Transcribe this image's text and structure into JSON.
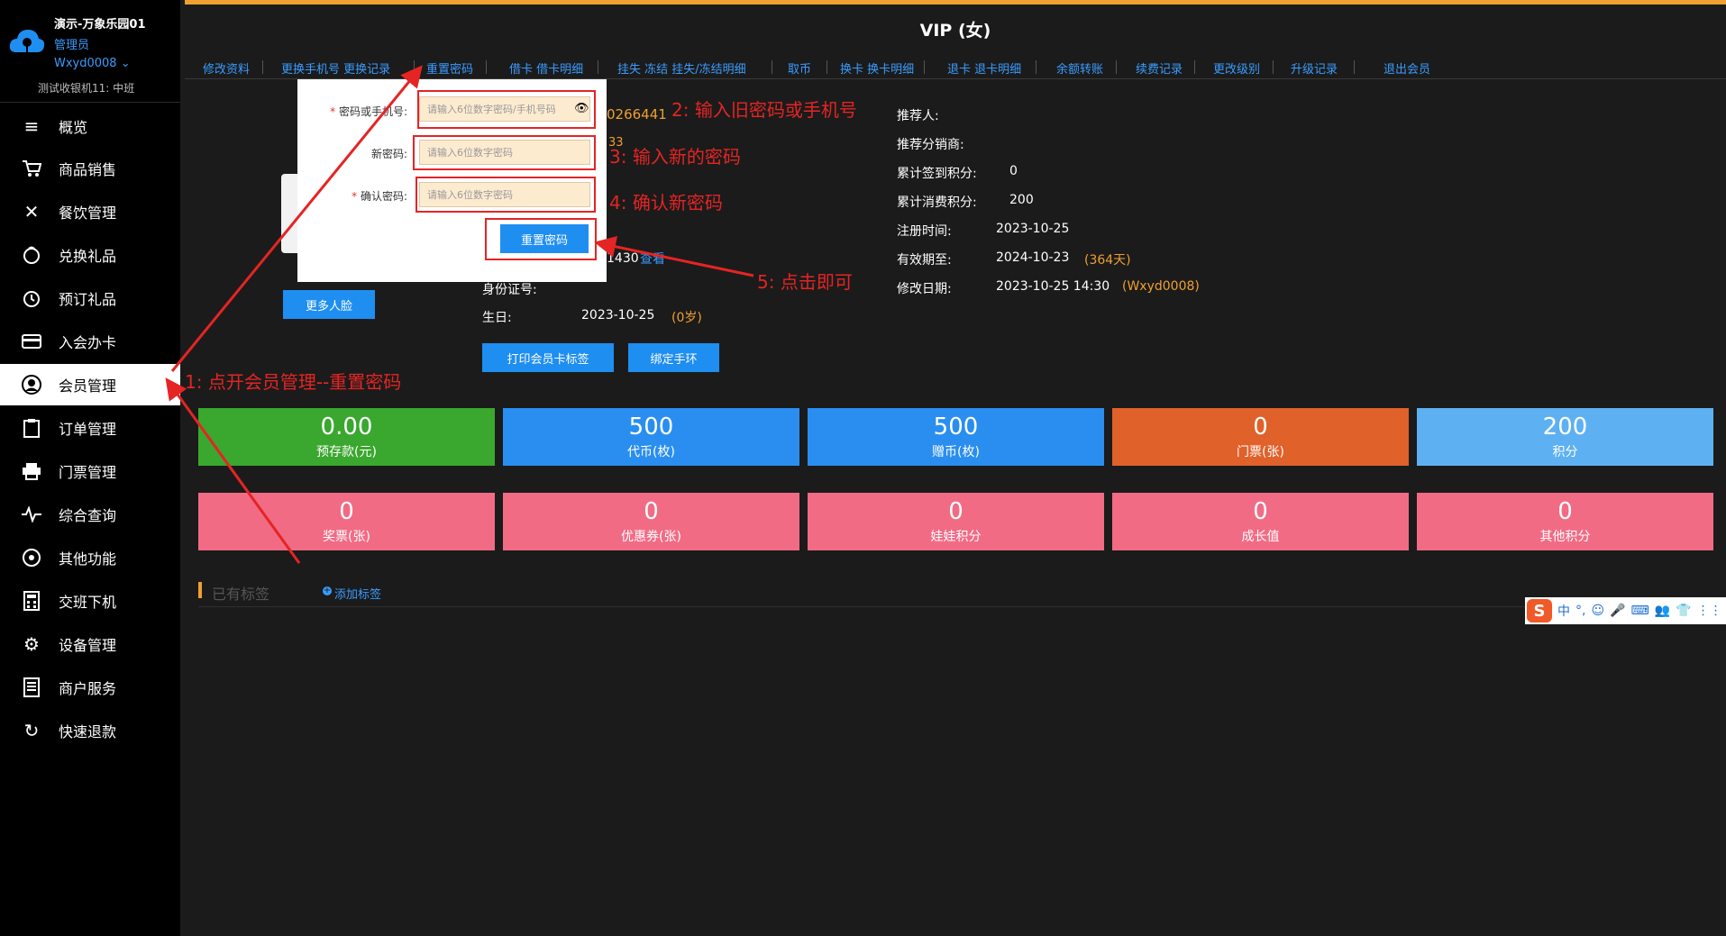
{
  "sidebar": {
    "shop_name": "演示-万象乐园01",
    "role": "管理员",
    "user": "Wxyd0008 ⌄",
    "shift": "测试收银机11: 中班",
    "items": [
      {
        "label": "概览",
        "icon": "menu-icon"
      },
      {
        "label": "商品销售",
        "icon": "cart-icon"
      },
      {
        "label": "餐饮管理",
        "icon": "utensils-icon"
      },
      {
        "label": "兑换礼品",
        "icon": "gift-icon"
      },
      {
        "label": "预订礼品",
        "icon": "alarm-clock-icon"
      },
      {
        "label": "入会办卡",
        "icon": "card-icon"
      },
      {
        "label": "会员管理",
        "icon": "user-icon"
      },
      {
        "label": "订单管理",
        "icon": "clipboard-icon"
      },
      {
        "label": "门票管理",
        "icon": "printer-icon"
      },
      {
        "label": "综合查询",
        "icon": "pulse-icon"
      },
      {
        "label": "其他功能",
        "icon": "aperture-icon"
      },
      {
        "label": "交班下机",
        "icon": "calculator-icon"
      },
      {
        "label": "设备管理",
        "icon": "gear-icon"
      },
      {
        "label": "商户服务",
        "icon": "document-icon"
      },
      {
        "label": "快速退款",
        "icon": "refresh-icon"
      }
    ]
  },
  "main": {
    "title": "VIP (女)",
    "tabs": [
      "修改资料",
      "更换手机号 更换记录",
      "重置密码",
      "借卡 借卡明细",
      "挂失 冻结 挂失/冻结明细",
      "取币",
      "换卡 换卡明细",
      "退卡 退卡明细",
      "余额转账",
      "续费记录",
      "更改级别",
      "升级记录",
      "退出会员"
    ],
    "partial_values": {
      "phone_fragment": "0266441",
      "frag_33": "33",
      "frag_1430": "1430",
      "frag_view": "查看",
      "id_label": "身份证号:"
    },
    "birthday_label": "生日:",
    "birthday_value": "2023-10-25",
    "birthday_age": "(0岁)",
    "right_info": [
      {
        "label": "推荐人:",
        "value": "",
        "extra": ""
      },
      {
        "label": "推荐分销商:",
        "value": "",
        "extra": ""
      },
      {
        "label": "累计签到积分:",
        "value": "0",
        "extra": ""
      },
      {
        "label": "累计消费积分:",
        "value": "200",
        "extra": ""
      },
      {
        "label": "注册时间:",
        "value": "2023-10-25",
        "extra": ""
      },
      {
        "label": "有效期至:",
        "value": "2024-10-23",
        "extra": "(364天)"
      },
      {
        "label": "修改日期:",
        "value": "2023-10-25 14:30",
        "extra": "(Wxyd0008)"
      }
    ],
    "more_face_btn": "更多人脸",
    "print_btn": "打印会员卡标签",
    "bind_btn": "绑定手环",
    "stats_row1": [
      {
        "value": "0.00",
        "caption": "预存款(元)",
        "color": "#3aa72e"
      },
      {
        "value": "500",
        "caption": "代币(枚)",
        "color": "#2a8ef0"
      },
      {
        "value": "500",
        "caption": "赠币(枚)",
        "color": "#2a8ef0"
      },
      {
        "value": "0",
        "caption": "门票(张)",
        "color": "#e0612a"
      },
      {
        "value": "200",
        "caption": "积分",
        "color": "#5db1f2"
      }
    ],
    "stats_row2": [
      {
        "value": "0",
        "caption": "奖票(张)",
        "color": "#f26b85"
      },
      {
        "value": "0",
        "caption": "优惠券(张)",
        "color": "#f26b85"
      },
      {
        "value": "0",
        "caption": "娃娃积分",
        "color": "#f26b85"
      },
      {
        "value": "0",
        "caption": "成长值",
        "color": "#f26b85"
      },
      {
        "value": "0",
        "caption": "其他积分",
        "color": "#f26b85"
      }
    ],
    "tags_title": "已有标签",
    "add_tag": "添加标签"
  },
  "modal": {
    "old_pwd_label": "密码或手机号:",
    "old_pwd_placeholder": "请输入6位数字密码/手机号码",
    "new_pwd_label": "新密码:",
    "new_pwd_placeholder": "请输入6位数字密码",
    "confirm_label": "确认密码:",
    "confirm_placeholder": "请输入6位数字密码",
    "submit": "重置密码"
  },
  "annotations": {
    "step1": "1: 点开会员管理--重置密码",
    "step2": "2: 输入旧密码或手机号",
    "step3": "3: 输入新的密码",
    "step4": "4: 确认新密码",
    "step5": "5: 点击即可",
    "color": "#e52424"
  },
  "ime": {
    "logo": "S",
    "items": [
      "中",
      "°,",
      "☺",
      "🎤",
      "⌨",
      "👥",
      "👕",
      "⋮⋮"
    ]
  }
}
